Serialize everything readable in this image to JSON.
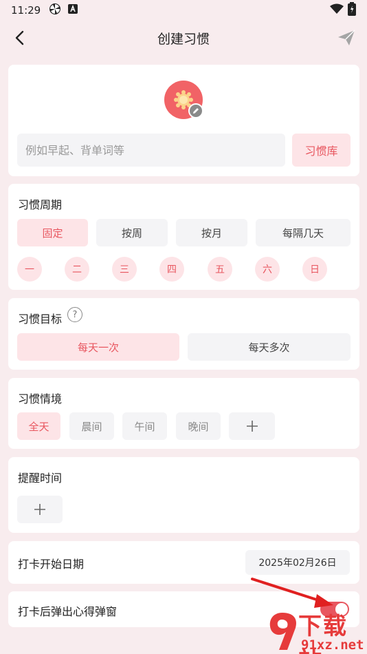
{
  "status_bar": {
    "time": "11:29"
  },
  "header": {
    "title": "创建习惯"
  },
  "basic": {
    "name_placeholder": "例如早起、背单词等",
    "library_label": "习惯库"
  },
  "period": {
    "title": "习惯周期",
    "options": [
      "固定",
      "按周",
      "按月",
      "每隔几天"
    ],
    "selected": "固定",
    "days": [
      "一",
      "二",
      "三",
      "四",
      "五",
      "六",
      "日"
    ]
  },
  "goal": {
    "title": "习惯目标",
    "help": "?",
    "options": [
      "每天一次",
      "每天多次"
    ],
    "selected": "每天一次"
  },
  "context": {
    "title": "习惯情境",
    "options": [
      "全天",
      "晨间",
      "午间",
      "晚间"
    ],
    "selected": "全天"
  },
  "reminder": {
    "title": "提醒时间"
  },
  "start_date": {
    "title": "打卡开始日期",
    "value": "2025年02月26日"
  },
  "popup": {
    "title": "打卡后弹出心得弹窗",
    "enabled": true
  },
  "watermark": {
    "big": "下载站",
    "small": "91xz.net"
  },
  "colors": {
    "accent": "#e8565f",
    "accent_soft": "#fde4e7",
    "page_bg": "#f8ecee"
  }
}
